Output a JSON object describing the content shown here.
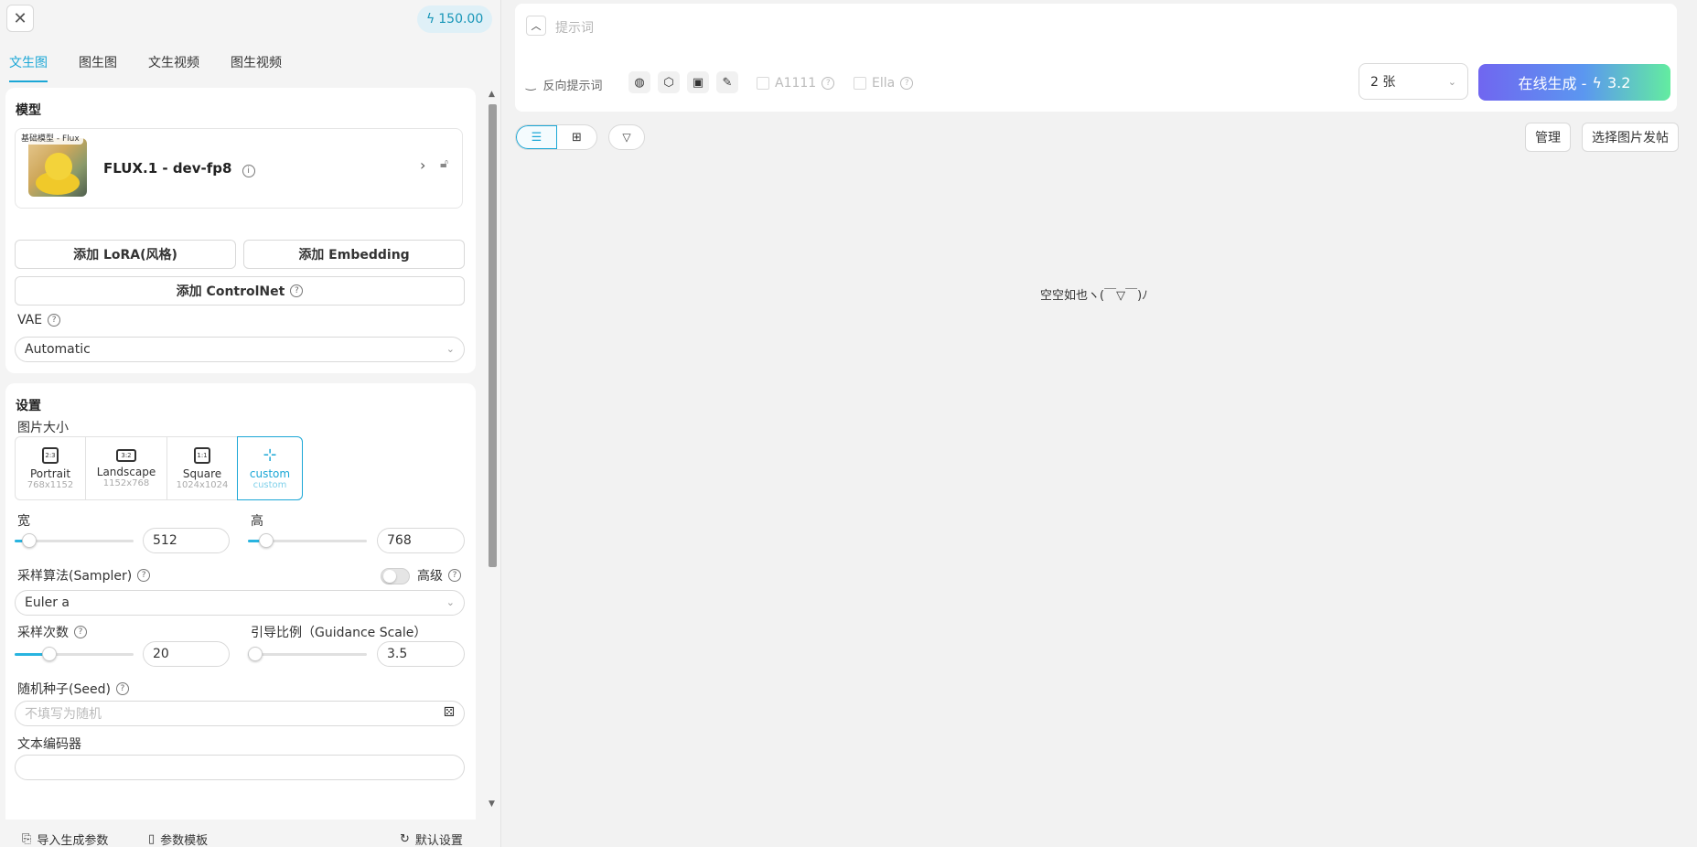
{
  "header": {
    "close_icon": "close-icon",
    "balance": "150.00",
    "balance_icon": "lightning-icon"
  },
  "tabs": [
    {
      "label": "文生图",
      "active": true
    },
    {
      "label": "图生图",
      "active": false
    },
    {
      "label": "文生视频",
      "active": false
    },
    {
      "label": "图生视频",
      "active": false
    }
  ],
  "model_section": {
    "title": "模型",
    "tag": "基础模型 - Flux",
    "model_name": "FLUX.1 - dev-fp8",
    "add_lora": "添加 LoRA(风格)",
    "add_embedding": "添加 Embedding",
    "add_controlnet": "添加 ControlNet",
    "vae_label": "VAE",
    "vae_value": "Automatic"
  },
  "settings": {
    "title": "设置",
    "size_label": "图片大小",
    "sizes": [
      {
        "icon": "2:3",
        "name": "Portrait",
        "dim": "768x1152"
      },
      {
        "icon": "3:2",
        "name": "Landscape",
        "dim": "1152x768"
      },
      {
        "icon": "1:1",
        "name": "Square",
        "dim": "1024x1024"
      },
      {
        "icon": "sliders",
        "name": "custom",
        "dim": "custom",
        "active": true
      }
    ],
    "width_label": "宽",
    "width_value": "512",
    "height_label": "高",
    "height_value": "768",
    "sampler_label": "采样算法(Sampler)",
    "advanced_label": "高级",
    "sampler_value": "Euler a",
    "steps_label": "采样次数",
    "steps_value": "20",
    "guidance_label": "引导比例（Guidance Scale）",
    "guidance_value": "3.5",
    "seed_label": "随机种子(Seed)",
    "seed_placeholder": "不填写为随机",
    "text_encoder_label": "文本编码器"
  },
  "footer": {
    "import_label": "导入生成参数",
    "template_label": "参数模板",
    "default_label": "默认设置"
  },
  "prompt": {
    "placeholder": "提示词",
    "negative_label": "反向提示词",
    "a1111_label": "A1111",
    "ella_label": "Ella",
    "count_value": "2 张",
    "generate_label": "在线生成 -",
    "generate_cost": "3.2"
  },
  "toolbar": {
    "manage_label": "管理",
    "post_label": "选择图片发帖"
  },
  "empty_text": "空空如也ヽ(￣▽￣)ﾉ",
  "colors": {
    "accent": "#1ba7d6",
    "generate_gradient_start": "#7066f0",
    "generate_gradient_end": "#63eca0"
  }
}
